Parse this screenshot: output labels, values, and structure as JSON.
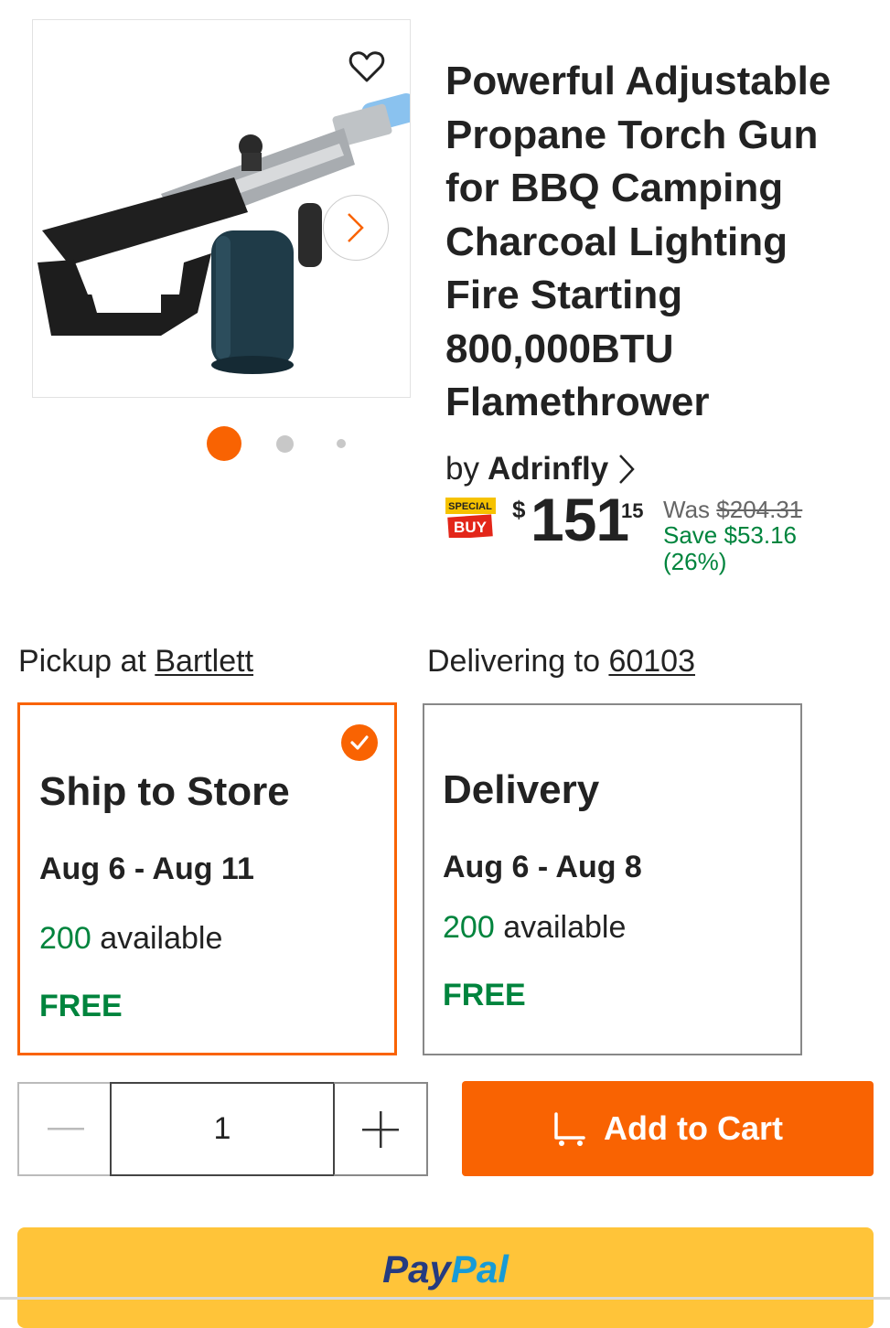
{
  "product": {
    "title_lines": [
      "Powerful Adjustable",
      "Propane Torch Gun",
      "for BBQ Camping",
      "Charcoal Lighting",
      "Fire Starting",
      "800,000BTU",
      "Flamethrower"
    ],
    "brand_prefix": "by",
    "brand": "Adrinfly",
    "badge_top": "SPECIAL",
    "badge_bottom": "BUY",
    "price_symbol": "$",
    "price_dollars": "151",
    "price_cents": "15",
    "was_label": "Was",
    "was_price": "$204.31",
    "save_text": "Save $53.16",
    "save_percent": "(26%)",
    "image_dots": {
      "count": 3,
      "active_index": 0
    }
  },
  "fulfillment": {
    "pickup_prefix": "Pickup at",
    "pickup_store": "Bartlett",
    "delivery_prefix": "Delivering to",
    "delivery_zip": "60103",
    "options": [
      {
        "title": "Ship to Store",
        "dates": "Aug 6 - Aug 11",
        "available_count": "200",
        "available_label": "available",
        "price": "FREE",
        "selected": true
      },
      {
        "title": "Delivery",
        "dates": "Aug 6 - Aug 8",
        "available_count": "200",
        "available_label": "available",
        "price": "FREE",
        "selected": false
      }
    ]
  },
  "quantity": {
    "value": "1"
  },
  "actions": {
    "add_to_cart": "Add to Cart",
    "paypal_part1": "Pay",
    "paypal_part2": "Pal"
  },
  "colors": {
    "brand_orange": "#f96302",
    "success_green": "#00843d",
    "paypal_yellow": "#ffc439"
  }
}
